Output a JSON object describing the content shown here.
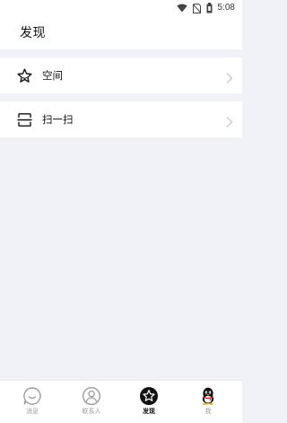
{
  "status_bar": {
    "time": "5:08",
    "icons": [
      "wifi-icon",
      "no-sim-icon",
      "battery-icon"
    ]
  },
  "header": {
    "title": "发现"
  },
  "list": {
    "items": [
      {
        "label": "空间",
        "icon": "star-icon"
      },
      {
        "label": "扫一扫",
        "icon": "scan-icon"
      }
    ]
  },
  "tabbar": {
    "tabs": [
      {
        "label": "消息",
        "icon": "messages-icon",
        "active": false
      },
      {
        "label": "联系人",
        "icon": "contacts-icon",
        "active": false
      },
      {
        "label": "发现",
        "icon": "discover-star-icon",
        "active": true
      },
      {
        "label": "我",
        "icon": "penguin-icon",
        "active": false
      }
    ]
  },
  "colors": {
    "background": "#f1f2f7",
    "surface": "#ffffff",
    "active_text": "#111111",
    "inactive_text": "#9a9ca3",
    "chevron": "#c4c6cc"
  }
}
